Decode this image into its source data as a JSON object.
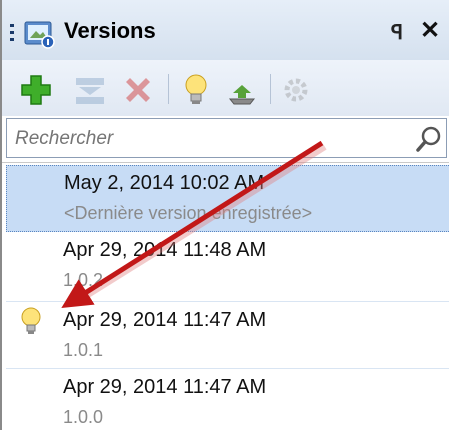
{
  "window": {
    "title": "Versions",
    "pin_glyph": "ᵖ",
    "close_glyph": "✕"
  },
  "toolbar": {
    "buttons": [
      {
        "name": "add-icon"
      },
      {
        "name": "merge-icon"
      },
      {
        "name": "delete-icon"
      },
      {
        "name": "lightbulb-icon"
      },
      {
        "name": "restore-icon"
      },
      {
        "name": "settings-icon"
      }
    ]
  },
  "search": {
    "placeholder": "Rechercher"
  },
  "versions": [
    {
      "date": "May 2, 2014 10:02 AM",
      "version": "<Dernière version enregistrée>",
      "selected": true,
      "bulb": false
    },
    {
      "date": "Apr 29, 2014 11:48 AM",
      "version": "1.0.2",
      "selected": false,
      "bulb": false
    },
    {
      "date": "Apr 29, 2014 11:47 AM",
      "version": "1.0.1",
      "selected": false,
      "bulb": true
    },
    {
      "date": "Apr 29, 2014 11:47 AM",
      "version": "1.0.0",
      "selected": false,
      "bulb": false
    }
  ],
  "colors": {
    "accent": "#c7dcf5",
    "arrow": "#c21818"
  }
}
